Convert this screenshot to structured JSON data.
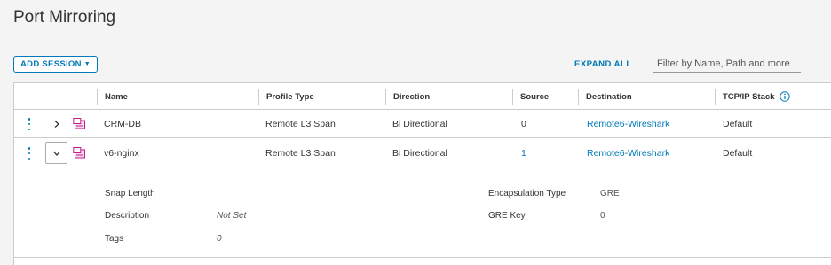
{
  "page": {
    "title": "Port Mirroring"
  },
  "toolbar": {
    "add_session_label": "ADD SESSION",
    "expand_all_label": "EXPAND ALL",
    "filter_placeholder": "Filter by Name, Path and more"
  },
  "table": {
    "columns": [
      "Name",
      "Profile Type",
      "Direction",
      "Source",
      "Destination",
      "TCP/IP Stack"
    ],
    "rows": [
      {
        "name": "CRM-DB",
        "profile_type": "Remote L3 Span",
        "direction": "Bi Directional",
        "source": "0",
        "destination": "Remote6-Wireshark",
        "tcp_ip_stack": "Default",
        "expanded": false
      },
      {
        "name": "v6-nginx",
        "profile_type": "Remote L3 Span",
        "direction": "Bi Directional",
        "source": "1",
        "destination": "Remote6-Wireshark",
        "tcp_ip_stack": "Default",
        "expanded": true
      }
    ]
  },
  "details": {
    "snap_length_label": "Snap Length",
    "snap_length_value": "",
    "description_label": "Description",
    "description_value": "Not Set",
    "tags_label": "Tags",
    "tags_value": "0",
    "encapsulation_label": "Encapsulation Type",
    "encapsulation_value": "GRE",
    "gre_key_label": "GRE Key",
    "gre_key_value": "0"
  },
  "colors": {
    "accent": "#0079b8",
    "vm_icon": "#c21d8a",
    "border": "#cccccc"
  },
  "icons": {
    "info": "info-icon",
    "kebab": "more-vertical-icon",
    "expand": "chevron-right-icon",
    "collapse": "chevron-down-icon",
    "vm": "vm-group-icon"
  }
}
